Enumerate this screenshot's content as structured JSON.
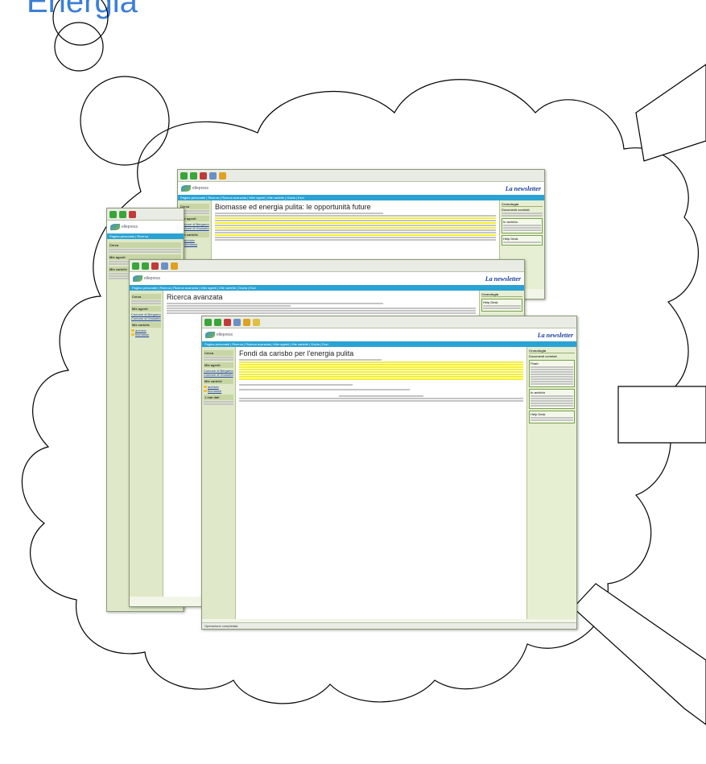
{
  "title": "Energia",
  "windows": [
    {
      "nav": "Pagina personale | Ricerca | Ricerca avanzata | Mier agenti | Mie cartelle | Guida | Esci",
      "heading": "Biomasse ed energia pulita: le opportunità future",
      "newsletter": "La newsletter",
      "left_search": "Cerca",
      "left_items": [
        "Mie agenti",
        "Comune di Bergamo",
        "Comune di Grosseto",
        "Mie cartelle",
        "archivio",
        "biomasse"
      ],
      "right_title": "Cronologia",
      "right_items": [
        "Documenti correlati",
        "In archivio",
        "Help Desk"
      ],
      "status": ""
    },
    {
      "nav": "Pagina personale | Ricerca | Ricerca avanzata | Mier agenti | Mie cartelle | Guida | Esci",
      "heading": "Ricerca avanzata",
      "newsletter": "La newsletter",
      "left_search": "Cerca",
      "left_items": [
        "Mie agenti",
        "Comune di Bergamo",
        "Comune di Grosseto",
        "Mie cartelle",
        "archivio",
        "biomasse"
      ],
      "right_title": "Cronologia",
      "right_items": [
        "Help Desk"
      ],
      "status": ""
    },
    {
      "nav": "Pagina personale | Ricerca | Ricerca avanzata | Mier agenti | Mie cartelle | Guida | Esci",
      "heading": "Fondi da carisbo per l'energia pulita",
      "newsletter": "La newsletter",
      "left_search": "Cerca",
      "left_items": [
        "Mie agenti",
        "Comune di Bergamo",
        "Comune di Grosseto",
        "Mie cartelle",
        "archivio",
        "biomasse",
        "1 mai dati"
      ],
      "right_title": "Cronologia",
      "right_items": [
        "Documenti correlati",
        "Flash",
        "In archivio",
        "Help Desk"
      ],
      "status": "Operazione completata"
    }
  ]
}
